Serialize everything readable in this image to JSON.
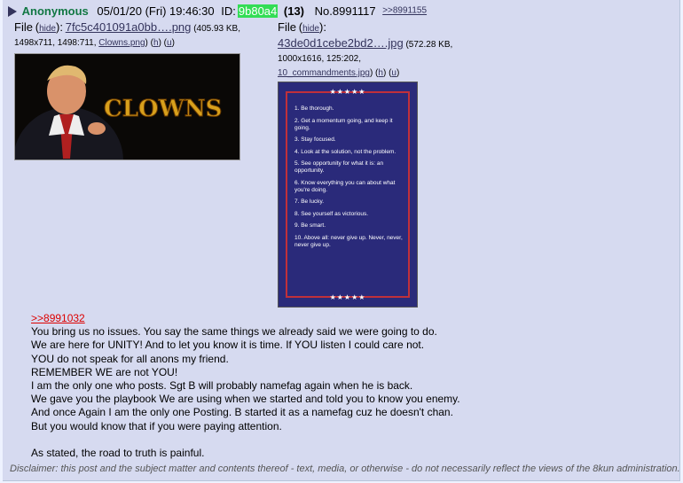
{
  "post": {
    "name": "Anonymous",
    "date": "05/01/20 (Fri) 19:46:30",
    "id_label": "ID:",
    "id": "9b80a4",
    "post_count": "(13)",
    "number": "No.8991117",
    "backlink": ">>8991155"
  },
  "files": [
    {
      "label": "File",
      "hide": "hide",
      "name": "7fc5c401091a0bb….png",
      "info": "(405.93 KB, 1498x711, 1498:711,",
      "original": "Clowns.png",
      "h": "h",
      "u": "u"
    },
    {
      "label": "File",
      "hide": "hide",
      "name": "43de0d1cebe2bd2….jpg",
      "info": "(572.28 KB, 1000x1616, 125:202,",
      "original": "10_commandments.jpg",
      "h": "h",
      "u": "u"
    }
  ],
  "thumb1": {
    "text": "CLOWNS"
  },
  "thumb2": {
    "stars": "★★★★★",
    "items": [
      "1. Be thorough.",
      "2. Get a momentum going, and keep it going.",
      "3. Stay focused.",
      "4. Look at the solution, not the problem.",
      "5. See opportunity for what it is: an opportunity.",
      "6. Know everything you can about what you're doing.",
      "7. Be lucky.",
      "8. See yourself as victorious.",
      "9. Be smart.",
      "10. Above all: never give up. Never, never, never give up."
    ]
  },
  "body": {
    "quote": ">>8991032",
    "lines": [
      "You bring us no issues. You say the same things we already said we were going to do.",
      "We are here for UNITY! And to let you know it is time. If YOU listen I could care not.",
      "YOU do not speak for all anons my friend.",
      "REMEMBER WE are not YOU!",
      "I am the only one who posts. Sgt B will probably namefag again when he is back.",
      "We gave you the playbook We are using when we started and told you to know you enemy.",
      "And once Again I am the only one Posting. B started it as a namefag cuz he doesn't chan.",
      "But you would know that if you were paying attention.",
      "",
      "As stated, the road to truth is painful."
    ]
  },
  "disclaimer": "Disclaimer: this post and the subject matter and contents thereof - text, media, or otherwise - do not necessarily reflect the views of the 8kun administration.",
  "colors": {
    "post_bg": "#d6daf0",
    "name": "#117743",
    "id_bg": "#33dd55",
    "quote": "#dd0000",
    "link": "#34345c"
  }
}
